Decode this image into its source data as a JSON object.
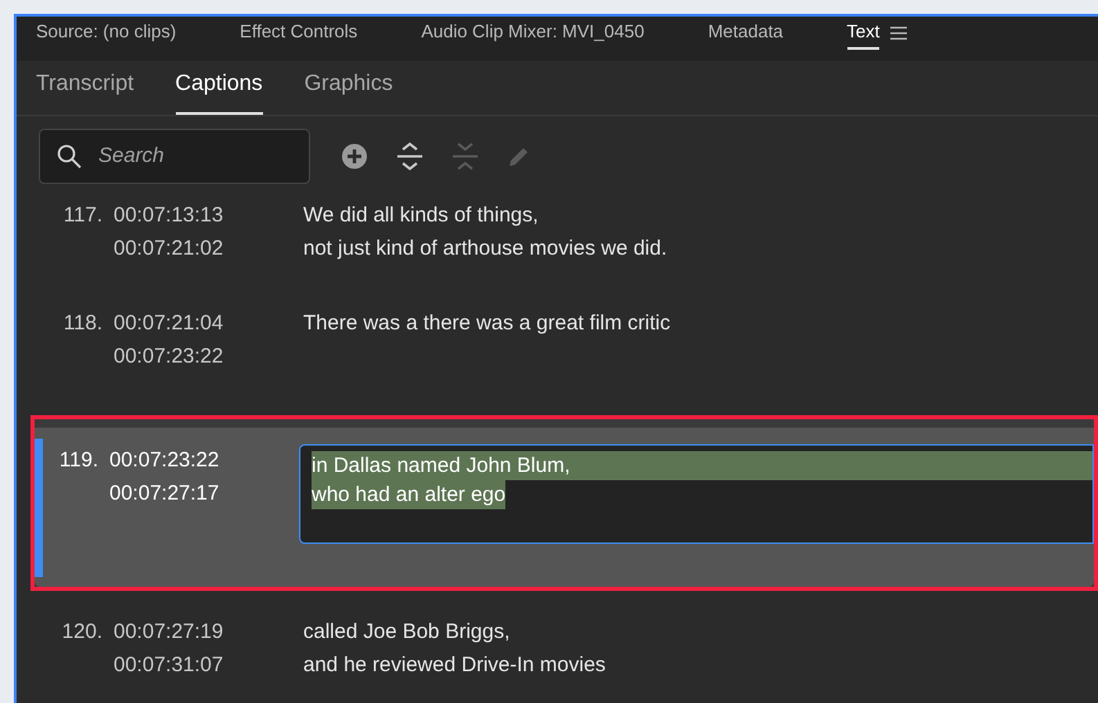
{
  "panel_tabs": [
    {
      "label": "Source: (no clips)",
      "selected": false
    },
    {
      "label": "Effect Controls",
      "selected": false
    },
    {
      "label": "Audio Clip Mixer: MVI_0450",
      "selected": false
    },
    {
      "label": "Metadata",
      "selected": false
    },
    {
      "label": "Text",
      "selected": true
    }
  ],
  "sub_tabs": [
    {
      "label": "Transcript",
      "selected": false
    },
    {
      "label": "Captions",
      "selected": true
    },
    {
      "label": "Graphics",
      "selected": false
    }
  ],
  "search": {
    "placeholder": "Search"
  },
  "toolbar": [
    {
      "kind": "add",
      "disabled": false
    },
    {
      "kind": "split",
      "disabled": false
    },
    {
      "kind": "merge",
      "disabled": true
    },
    {
      "kind": "edit",
      "disabled": true
    }
  ],
  "captions": [
    {
      "number": "117.",
      "start": "00:07:13:13",
      "end": "00:07:21:02",
      "lines": [
        "We did all kinds of things,",
        "not just kind of arthouse movies we did."
      ],
      "selected": false,
      "editing": false
    },
    {
      "number": "118.",
      "start": "00:07:21:04",
      "end": "00:07:23:22",
      "lines": [
        "There was a there was a great film critic"
      ],
      "selected": false,
      "editing": false
    },
    {
      "number": "119.",
      "start": "00:07:23:22",
      "end": "00:07:27:17",
      "lines": [
        "in Dallas named John Blum,",
        "who had an alter ego"
      ],
      "selected": true,
      "editing": true
    },
    {
      "number": "120.",
      "start": "00:07:27:19",
      "end": "00:07:31:07",
      "lines": [
        "called Joe Bob Briggs,",
        "and he reviewed Drive-In movies"
      ],
      "selected": false,
      "editing": false
    }
  ]
}
